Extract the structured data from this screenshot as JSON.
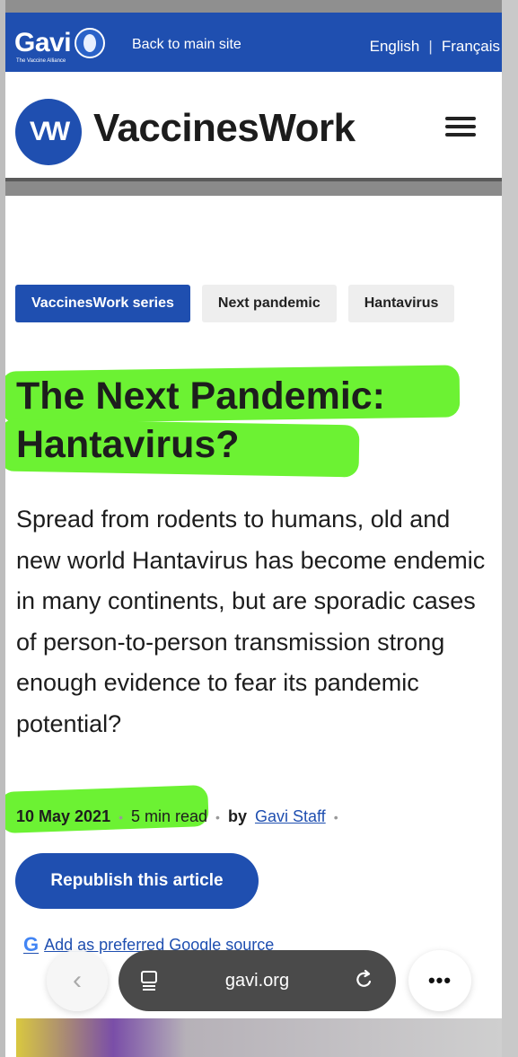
{
  "gavi_bar": {
    "logo_text": "Gavi",
    "logo_subtitle": "The Vaccine Alliance",
    "back_link": "Back to main site",
    "lang_en": "English",
    "lang_sep": "|",
    "lang_fr": "Français"
  },
  "header": {
    "logo_mark": "VW",
    "site_title": "VaccinesWork"
  },
  "tags": [
    "VaccinesWork series",
    "Next pandemic",
    "Hantavirus"
  ],
  "article": {
    "headline_line1": "The Next Pandemic:",
    "headline_line2": "Hantavirus?",
    "summary": "Spread from rodents to humans, old and new world Hantavirus has become endemic in many continents, but are sporadic cases of person-to-person transmission strong enough evidence to fear its pandemic potential?",
    "date": "10 May 2021",
    "read_time": "5 min read",
    "by_label": "by",
    "author": "Gavi Staff",
    "dot": "•",
    "republish_label": "Republish this article",
    "google_source_text": "Add as preferred Google source"
  },
  "browser": {
    "back_glyph": "‹",
    "url": "gavi.org",
    "more_glyph": "•••"
  },
  "colors": {
    "brand_blue": "#1f4fb0",
    "highlighter_green": "#6cf233"
  }
}
